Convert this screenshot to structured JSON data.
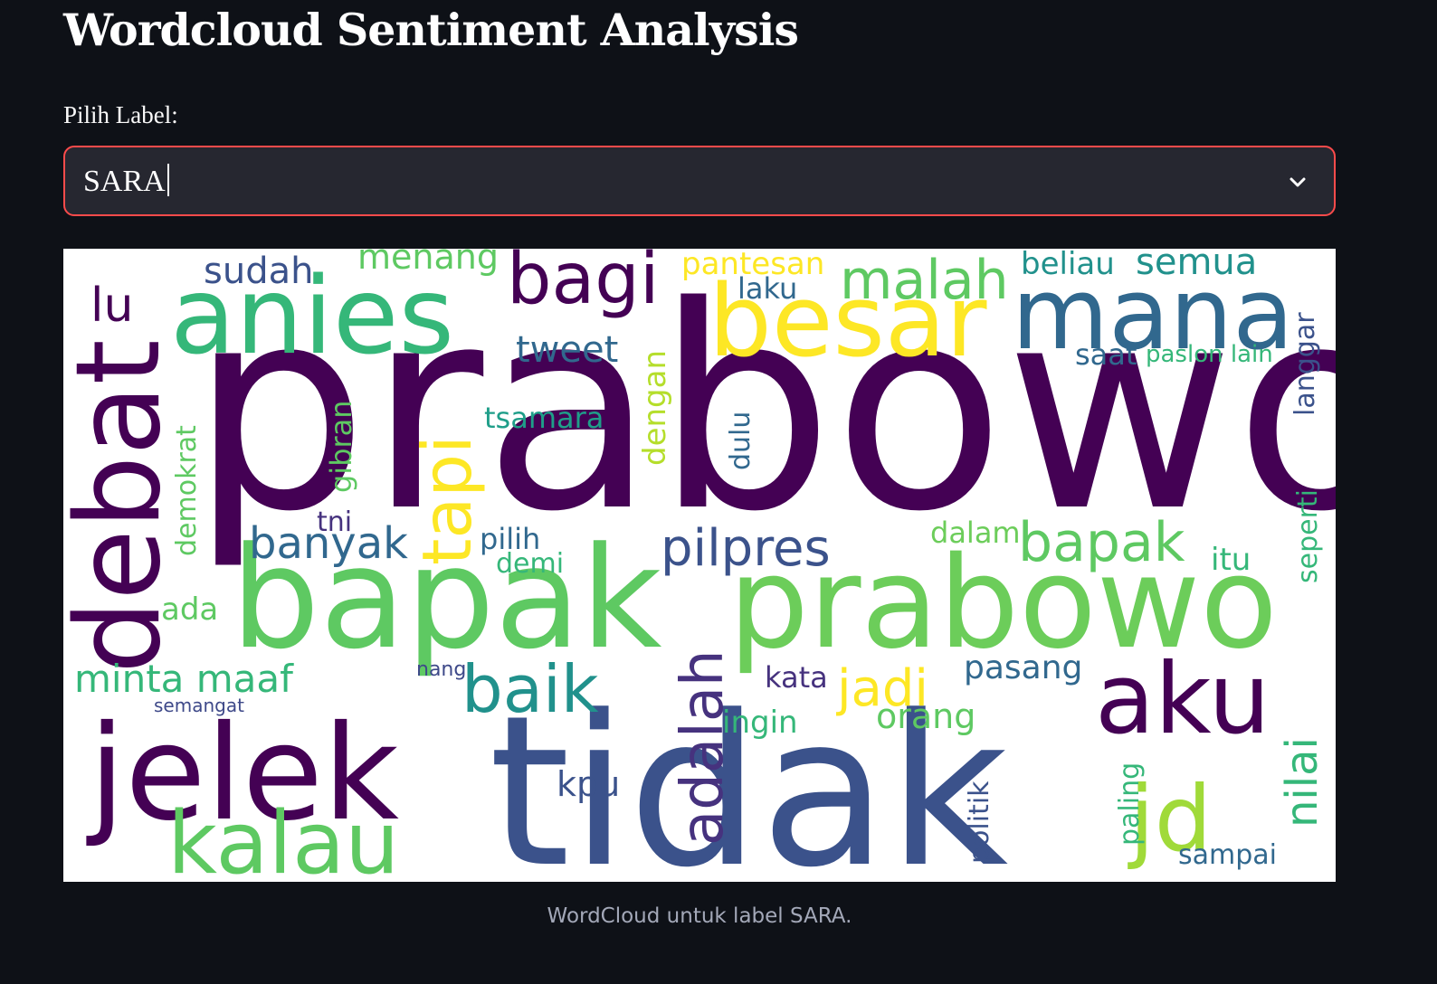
{
  "page": {
    "title": "Wordcloud Sentiment Analysis"
  },
  "select": {
    "label": "Pilih Label:",
    "value": "SARA",
    "icon": "chevron-down-icon",
    "border_color": "#ff4b4b"
  },
  "wordcloud": {
    "label": "SARA",
    "caption": "WordCloud untuk label SARA.",
    "palette": "viridis",
    "words": [
      {
        "text": "prabowo",
        "color": "#440154"
      },
      {
        "text": "tidak",
        "color": "#3b528b"
      },
      {
        "text": "bapak",
        "color": "#5ec962"
      },
      {
        "text": "prabowo",
        "color": "#6ccd5a"
      },
      {
        "text": "anies",
        "color": "#35b779"
      },
      {
        "text": "besar",
        "color": "#fde725"
      },
      {
        "text": "mana",
        "color": "#31688e"
      },
      {
        "text": "jelek",
        "color": "#440154"
      },
      {
        "text": "debat",
        "color": "#440154"
      },
      {
        "text": "kalau",
        "color": "#5ec962"
      },
      {
        "text": "aku",
        "color": "#440154"
      },
      {
        "text": "jd",
        "color": "#a0da39"
      },
      {
        "text": "bagi",
        "color": "#440154"
      },
      {
        "text": "malah",
        "color": "#5ec962"
      },
      {
        "text": "baik",
        "color": "#21918c"
      },
      {
        "text": "adalah",
        "color": "#46327e"
      },
      {
        "text": "tapi",
        "color": "#fde725"
      },
      {
        "text": "pilpres",
        "color": "#3b528b"
      },
      {
        "text": "bapak",
        "color": "#5ec962"
      },
      {
        "text": "banyak",
        "color": "#31688e"
      },
      {
        "text": "minta maaf",
        "color": "#35b779"
      },
      {
        "text": "jadi",
        "color": "#fde725"
      },
      {
        "text": "sudah",
        "color": "#3b528b"
      },
      {
        "text": "menang",
        "color": "#5ec962"
      },
      {
        "text": "semua",
        "color": "#21918c"
      },
      {
        "text": "beliau",
        "color": "#21918c"
      },
      {
        "text": "pantesan",
        "color": "#fde725"
      },
      {
        "text": "tweet",
        "color": "#31688e"
      },
      {
        "text": "tsamara",
        "color": "#1f9e89"
      },
      {
        "text": "dengan",
        "color": "#b5de2b"
      },
      {
        "text": "gibran",
        "color": "#5ec962"
      },
      {
        "text": "demokrat",
        "color": "#5ec962"
      },
      {
        "text": "lu",
        "color": "#440154"
      },
      {
        "text": "orang",
        "color": "#5ec962"
      },
      {
        "text": "ingin",
        "color": "#35b779"
      },
      {
        "text": "pasang",
        "color": "#31688e"
      },
      {
        "text": "kata",
        "color": "#46327e"
      },
      {
        "text": "kpu",
        "color": "#3b528b"
      },
      {
        "text": "ada",
        "color": "#5ec962"
      },
      {
        "text": "demi",
        "color": "#35b779"
      },
      {
        "text": "pilih",
        "color": "#31688e"
      },
      {
        "text": "tni",
        "color": "#46327e"
      },
      {
        "text": "dulu",
        "color": "#31688e"
      },
      {
        "text": "dalam",
        "color": "#6ccd5a"
      },
      {
        "text": "itu",
        "color": "#35b779"
      },
      {
        "text": "seperti",
        "color": "#35b779"
      },
      {
        "text": "nilai",
        "color": "#35b779"
      },
      {
        "text": "langgar",
        "color": "#3b528b"
      },
      {
        "text": "saat",
        "color": "#31688e"
      },
      {
        "text": "paslon lain",
        "color": "#35b779"
      },
      {
        "text": "laku",
        "color": "#31688e"
      },
      {
        "text": "politik",
        "color": "#3b528b"
      },
      {
        "text": "paling",
        "color": "#35b779"
      },
      {
        "text": "sampai",
        "color": "#31688e"
      },
      {
        "text": "semangat",
        "color": "#3e4989"
      },
      {
        "text": "nang",
        "color": "#3e4989"
      }
    ]
  }
}
